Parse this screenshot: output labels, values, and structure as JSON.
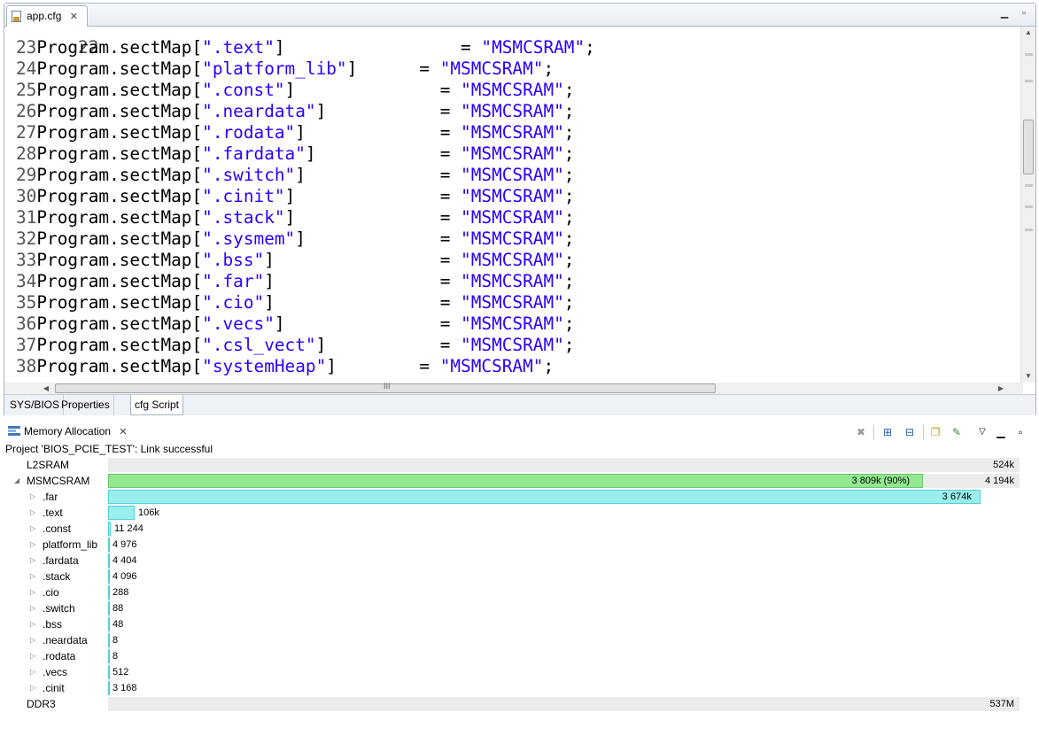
{
  "editor": {
    "tab_title": "app.cfg",
    "partial_line_number": "22",
    "lines": [
      {
        "num": "23",
        "prefix": "Program.sectMap[",
        "section": "\".text\"",
        "suffix": "]",
        "pad": "                 ",
        "eq": "= ",
        "value": "\"MSMCSRAM\"",
        "end": ";"
      },
      {
        "num": "24",
        "prefix": "Program.sectMap[",
        "section": "\"platform_lib\"",
        "suffix": "]",
        "pad": "      ",
        "eq": "= ",
        "value": "\"MSMCSRAM\"",
        "end": ";"
      },
      {
        "num": "25",
        "prefix": "Program.sectMap[",
        "section": "\".const\"",
        "suffix": "]",
        "pad": "              ",
        "eq": "= ",
        "value": "\"MSMCSRAM\"",
        "end": ";"
      },
      {
        "num": "26",
        "prefix": "Program.sectMap[",
        "section": "\".neardata\"",
        "suffix": "]",
        "pad": "           ",
        "eq": "= ",
        "value": "\"MSMCSRAM\"",
        "end": ";"
      },
      {
        "num": "27",
        "prefix": "Program.sectMap[",
        "section": "\".rodata\"",
        "suffix": "]",
        "pad": "             ",
        "eq": "= ",
        "value": "\"MSMCSRAM\"",
        "end": ";"
      },
      {
        "num": "28",
        "prefix": "Program.sectMap[",
        "section": "\".fardata\"",
        "suffix": "]",
        "pad": "            ",
        "eq": "= ",
        "value": "\"MSMCSRAM\"",
        "end": ";"
      },
      {
        "num": "29",
        "prefix": "Program.sectMap[",
        "section": "\".switch\"",
        "suffix": "]",
        "pad": "             ",
        "eq": "= ",
        "value": "\"MSMCSRAM\"",
        "end": ";"
      },
      {
        "num": "30",
        "prefix": "Program.sectMap[",
        "section": "\".cinit\"",
        "suffix": "]",
        "pad": "              ",
        "eq": "= ",
        "value": "\"MSMCSRAM\"",
        "end": ";"
      },
      {
        "num": "31",
        "prefix": "Program.sectMap[",
        "section": "\".stack\"",
        "suffix": "]",
        "pad": "              ",
        "eq": "= ",
        "value": "\"MSMCSRAM\"",
        "end": ";"
      },
      {
        "num": "32",
        "prefix": "Program.sectMap[",
        "section": "\".sysmem\"",
        "suffix": "]",
        "pad": "             ",
        "eq": "= ",
        "value": "\"MSMCSRAM\"",
        "end": ";"
      },
      {
        "num": "33",
        "prefix": "Program.sectMap[",
        "section": "\".bss\"",
        "suffix": "]",
        "pad": "                ",
        "eq": "= ",
        "value": "\"MSMCSRAM\"",
        "end": ";"
      },
      {
        "num": "34",
        "prefix": "Program.sectMap[",
        "section": "\".far\"",
        "suffix": "]",
        "pad": "                ",
        "eq": "= ",
        "value": "\"MSMCSRAM\"",
        "end": ";"
      },
      {
        "num": "35",
        "prefix": "Program.sectMap[",
        "section": "\".cio\"",
        "suffix": "]",
        "pad": "                ",
        "eq": "= ",
        "value": "\"MSMCSRAM\"",
        "end": ";"
      },
      {
        "num": "36",
        "prefix": "Program.sectMap[",
        "section": "\".vecs\"",
        "suffix": "]",
        "pad": "               ",
        "eq": "= ",
        "value": "\"MSMCSRAM\"",
        "end": ";"
      },
      {
        "num": "37",
        "prefix": "Program.sectMap[",
        "section": "\".csl_vect\"",
        "suffix": "]",
        "pad": "           ",
        "eq": "= ",
        "value": "\"MSMCSRAM\"",
        "end": ";"
      },
      {
        "num": "38",
        "prefix": "Program.sectMap[",
        "section": "\"systemHeap\"",
        "suffix": "]",
        "pad": "        ",
        "eq": "= ",
        "value": "\"MSMCSRAM\"",
        "end": ";"
      }
    ],
    "bottom_tabs": [
      "SYS/BIOS",
      "Properties",
      "cfg Script"
    ],
    "active_bottom_tab": "cfg Script",
    "scroll_grip": "III"
  },
  "memory": {
    "view_title": "Memory Allocation",
    "status": "Project 'BIOS_PCIE_TEST': Link successful",
    "rows": [
      {
        "name": "L2SRAM",
        "level": 0,
        "expander": "",
        "used_fraction": 0,
        "bar_color": "none",
        "label": "",
        "capacity": "524k"
      },
      {
        "name": "MSMCSRAM",
        "level": 0,
        "expander": "expanded",
        "used_fraction": 0.9,
        "bar_color": "#92e891",
        "label": "3 809k (90%)",
        "capacity": "4 194k"
      },
      {
        "name": ".far",
        "level": 1,
        "expander": "collapsed",
        "used_fraction": 0.964,
        "bar_color": "#9beeee",
        "label": "3 674k",
        "capacity": ""
      },
      {
        "name": ".text",
        "level": 1,
        "expander": "collapsed",
        "used_fraction": 0.029,
        "bar_color": "#9beeee",
        "label": "106k",
        "capacity": ""
      },
      {
        "name": ".const",
        "level": 1,
        "expander": "collapsed",
        "used_fraction": 0.003,
        "bar_color": "#9beeee",
        "label": "11 244",
        "capacity": ""
      },
      {
        "name": "platform_lib",
        "level": 1,
        "expander": "collapsed",
        "used_fraction": 0.0013,
        "bar_color": "#9beeee",
        "label": "4 976",
        "capacity": ""
      },
      {
        "name": ".fardata",
        "level": 1,
        "expander": "collapsed",
        "used_fraction": 0.0012,
        "bar_color": "#9beeee",
        "label": "4 404",
        "capacity": ""
      },
      {
        "name": ".stack",
        "level": 1,
        "expander": "collapsed",
        "used_fraction": 0.0011,
        "bar_color": "#9beeee",
        "label": "4 096",
        "capacity": ""
      },
      {
        "name": ".cio",
        "level": 1,
        "expander": "collapsed",
        "used_fraction": 0.0001,
        "bar_color": "#9beeee",
        "label": "288",
        "capacity": ""
      },
      {
        "name": ".switch",
        "level": 1,
        "expander": "collapsed",
        "used_fraction": 2e-05,
        "bar_color": "#9beeee",
        "label": "88",
        "capacity": ""
      },
      {
        "name": ".bss",
        "level": 1,
        "expander": "collapsed",
        "used_fraction": 1e-05,
        "bar_color": "#9beeee",
        "label": "48",
        "capacity": ""
      },
      {
        "name": ".neardata",
        "level": 1,
        "expander": "collapsed",
        "used_fraction": 2e-06,
        "bar_color": "#9beeee",
        "label": "8",
        "capacity": ""
      },
      {
        "name": ".rodata",
        "level": 1,
        "expander": "collapsed",
        "used_fraction": 2e-06,
        "bar_color": "#9beeee",
        "label": "8",
        "capacity": ""
      },
      {
        "name": ".vecs",
        "level": 1,
        "expander": "collapsed",
        "used_fraction": 0.0001,
        "bar_color": "#9beeee",
        "label": "512",
        "capacity": ""
      },
      {
        "name": ".cinit",
        "level": 1,
        "expander": "collapsed",
        "used_fraction": 0.0008,
        "bar_color": "#9beeee",
        "label": "3 168",
        "capacity": ""
      },
      {
        "name": "DDR3",
        "level": 0,
        "expander": "",
        "used_fraction": 0,
        "bar_color": "none",
        "label": "",
        "capacity": "537M"
      }
    ]
  }
}
